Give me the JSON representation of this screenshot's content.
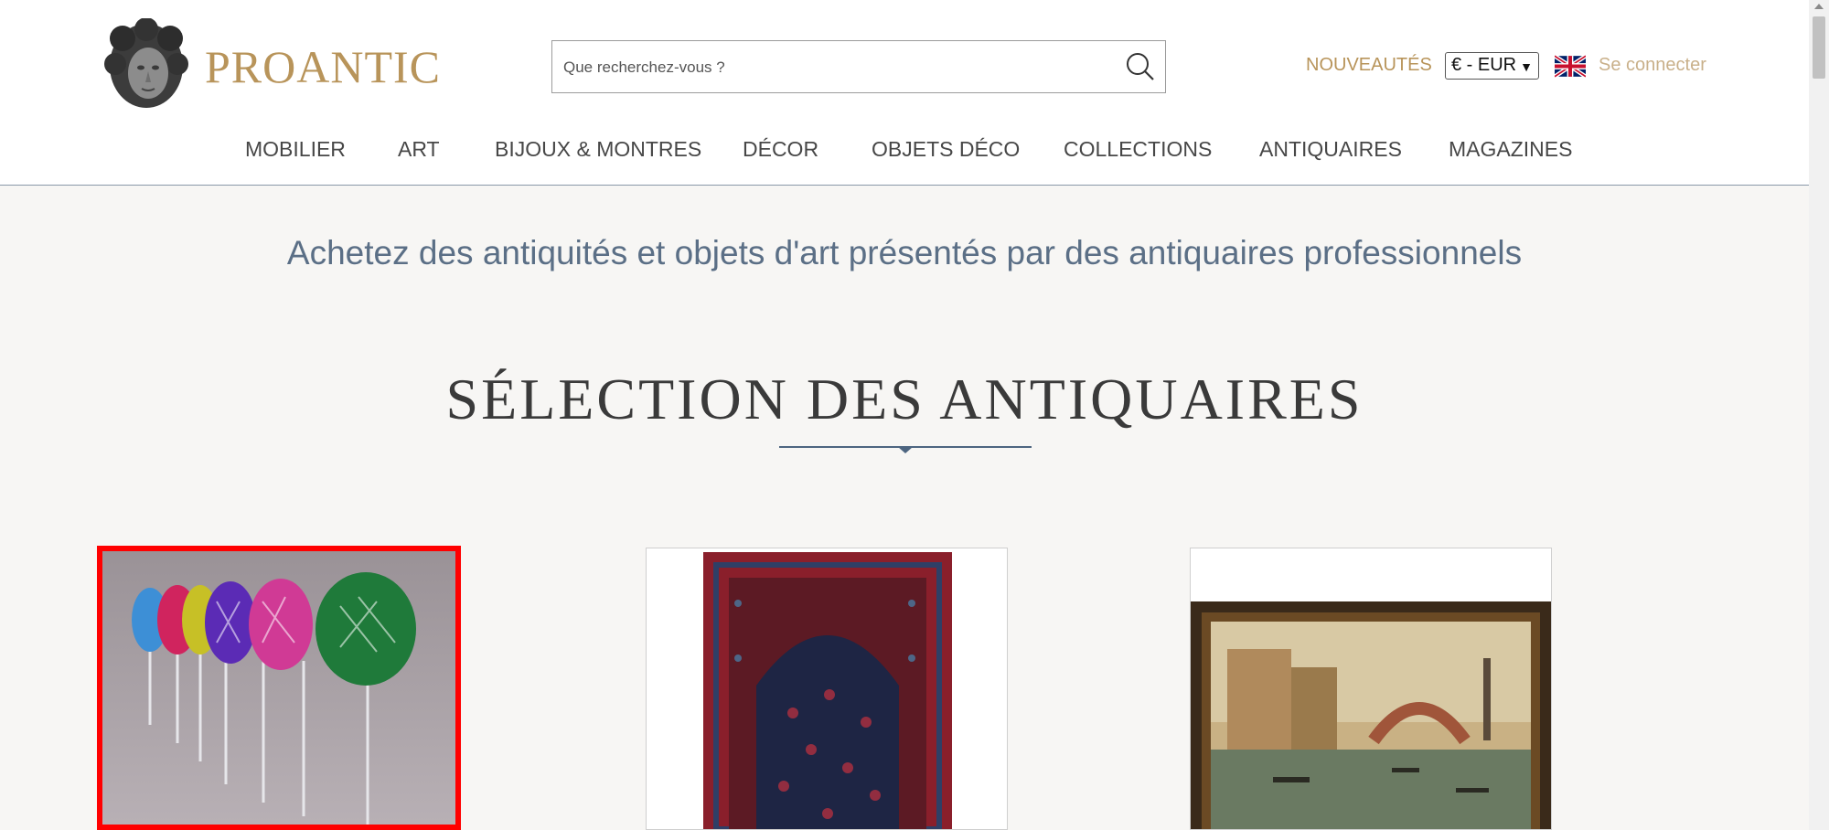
{
  "brand": {
    "name": "PROANTIC",
    "color": "#b8945a"
  },
  "search": {
    "placeholder": "Que recherchez-vous ?",
    "icon": "search-icon"
  },
  "header": {
    "new_label": "NOUVEAUTÉS",
    "currency": "€ - EUR",
    "language_flag": "uk-flag-icon",
    "login_label": "Se connecter"
  },
  "nav": {
    "items": [
      {
        "label": "MOBILIER"
      },
      {
        "label": "ART"
      },
      {
        "label": "BIJOUX & MONTRES"
      },
      {
        "label": "DÉCOR"
      },
      {
        "label": "OBJETS DÉCO"
      },
      {
        "label": "COLLECTIONS"
      },
      {
        "label": "ANTIQUAIRES"
      },
      {
        "label": "MAGAZINES"
      }
    ]
  },
  "main": {
    "tagline": "Achetez des antiquités et objets d'art présentés par des antiquaires professionnels",
    "section_title": "SÉLECTION DES ANTIQUAIRES",
    "products": [
      {
        "image": "colored-crystal-wine-glasses",
        "selected": true
      },
      {
        "image": "persian-prayer-rug"
      },
      {
        "image": "venetian-canal-painting"
      }
    ]
  },
  "colors": {
    "accent": "#b8945a",
    "tagline": "#5b6f86",
    "divider": "#4d6580",
    "selection": "#ff0000"
  }
}
